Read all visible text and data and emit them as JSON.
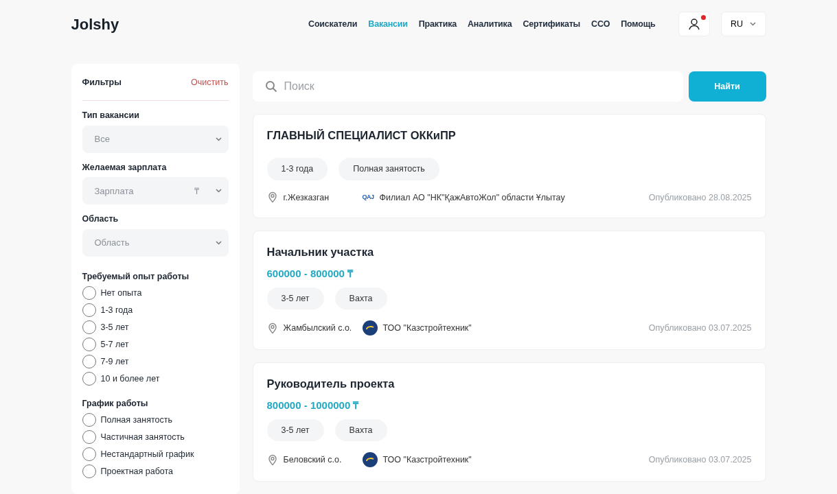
{
  "header": {
    "logo": "Jolshy",
    "nav": [
      {
        "label": "Соискатели",
        "selected": false
      },
      {
        "label": "Вакансии",
        "selected": true
      },
      {
        "label": "Практика",
        "selected": false
      },
      {
        "label": "Аналитика",
        "selected": false
      },
      {
        "label": "Сертификаты",
        "selected": false
      },
      {
        "label": "CCO",
        "selected": false
      },
      {
        "label": "Помощь",
        "selected": false
      }
    ],
    "notification": true,
    "language": "RU"
  },
  "filters": {
    "title": "Фильтры",
    "clear": "Очистить",
    "selects": [
      {
        "label": "Тип вакансии",
        "value": "Все"
      },
      {
        "label": "Желаемая зарплата",
        "placeholder": "Зарплата",
        "suffix": "₸"
      },
      {
        "label": "Область",
        "value": "Область"
      }
    ],
    "groups": [
      {
        "label": "Требуемый опыт работы",
        "options": [
          {
            "label": "Нет опыта",
            "selected": false
          },
          {
            "label": "1-3 года",
            "selected": false
          },
          {
            "label": "3-5 лет",
            "selected": false
          },
          {
            "label": "5-7 лет",
            "selected": false
          },
          {
            "label": "7-9 лет",
            "selected": false
          },
          {
            "label": "10 и более лет",
            "selected": false
          }
        ]
      },
      {
        "label": "График работы",
        "options": [
          {
            "label": "Полная занятость",
            "selected": false
          },
          {
            "label": "Частичная занятость",
            "selected": false
          },
          {
            "label": "Нестандартный график",
            "selected": false
          },
          {
            "label": "Проектная работа",
            "selected": false
          }
        ]
      }
    ]
  },
  "search": {
    "placeholder": "Поиск",
    "button": "Найти"
  },
  "vacancies": [
    {
      "title": "ГЛАВНЫЙ СПЕЦИАЛИСТ ОККиПР",
      "tags": [
        "1-3 года",
        "Полная занятость"
      ],
      "location": "г.Жезказган",
      "kind": "text",
      "logo_text": "QAJ",
      "company": "Филиал АО \"НК\"ҚажАвтоЖол\" области Ұлытау",
      "published": "Опубликовано 28.08.2025"
    },
    {
      "title": "Начальник участка",
      "salary": "600000 - 800000 ₸",
      "tags": [
        "3-5 лет",
        "Вахта"
      ],
      "location": "Жамбылский с.о.",
      "kind": "circle",
      "company": "ТОО \"Казстройтехник\"",
      "published": "Опубликовано 03.07.2025"
    },
    {
      "title": "Руководитель проекта",
      "salary": "800000 - 1000000 ₸",
      "tags": [
        "3-5 лет",
        "Вахта"
      ],
      "location": "Беловский с.о.",
      "kind": "circle",
      "company": "ТОО \"Казстройтехник\"",
      "published": "Опубликовано 03.07.2025"
    }
  ]
}
